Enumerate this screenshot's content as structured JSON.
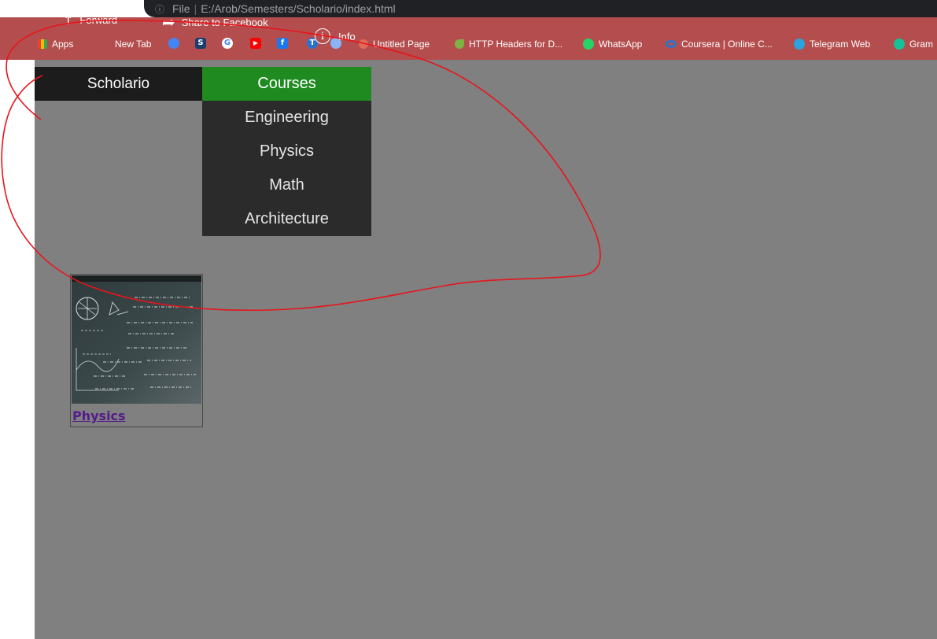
{
  "browser": {
    "address": {
      "scheme": "File",
      "separator": "|",
      "path": "E:/Arob/Semesters/Scholario/index.html"
    },
    "bookmarks": [
      {
        "label": "Apps",
        "color": "#f4b400"
      },
      {
        "label": "New Tab",
        "color": "#4285f4"
      },
      {
        "label": "Untitled Page",
        "color": "#e06c5a"
      },
      {
        "label": "HTTP Headers for D...",
        "color": "#7cb342"
      },
      {
        "label": "WhatsApp",
        "color": "#25d366"
      },
      {
        "label": "Coursera | Online C...",
        "color": "#2a73cc"
      },
      {
        "label": "Telegram Web",
        "color": "#2aa3e0"
      },
      {
        "label": "Gram",
        "color": "#15c39a"
      }
    ],
    "favicons": [
      {
        "glyph": "S",
        "color": "#1a3e6e"
      },
      {
        "glyph": "G",
        "color": "#4285f4"
      },
      {
        "glyph": "▶",
        "color": "#ff0000"
      },
      {
        "glyph": "f",
        "color": "#1877f2"
      },
      {
        "glyph": "T",
        "color": "#2a73cc"
      }
    ]
  },
  "share_menu": {
    "forward_label": "Forward",
    "facebook_label": "Share to Facebook",
    "info_label": "Info"
  },
  "site": {
    "brand": "Scholario",
    "courses_label": "Courses",
    "dropdown": [
      "Engineering",
      "Physics",
      "Math",
      "Architecture"
    ],
    "accent_color": "#1f8a1f"
  },
  "card": {
    "link_label": "Physics",
    "image": "physics-chalkboard-image"
  },
  "annotation": {
    "color": "#e8141b"
  }
}
